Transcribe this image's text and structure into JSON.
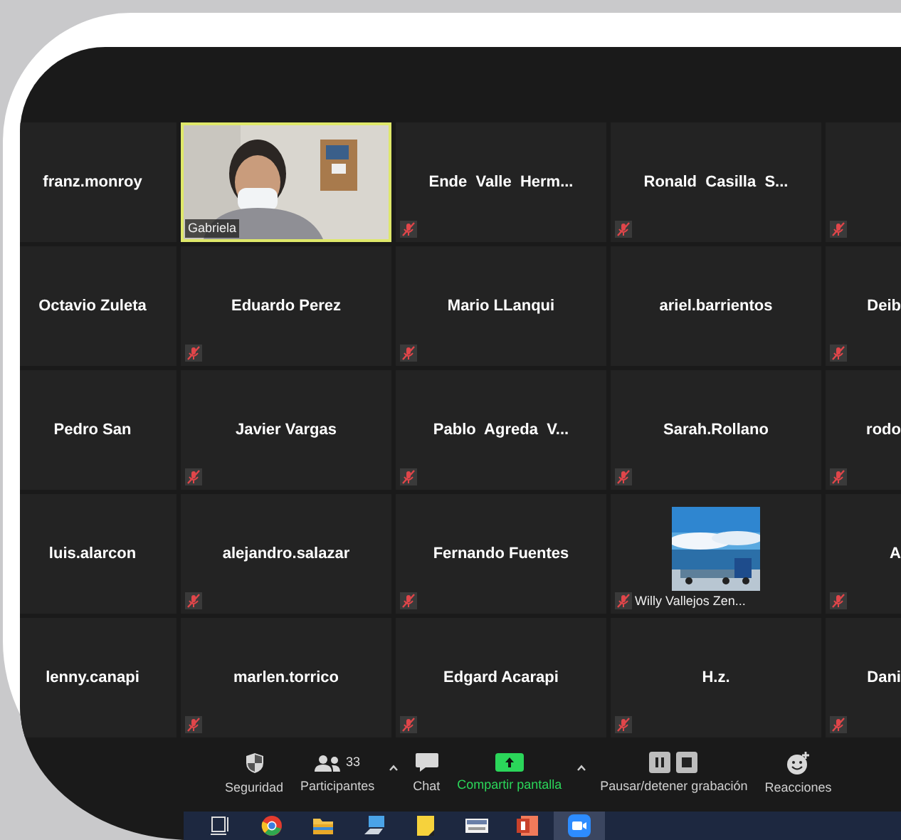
{
  "tiles": [
    {
      "kind": "name",
      "name": "franz.monroy",
      "muted": false,
      "active_speaker": false
    },
    {
      "kind": "video",
      "name": "Gabriela",
      "muted": false,
      "active_speaker": true
    },
    {
      "kind": "name",
      "name": "Ende  Valle  Herm...",
      "muted": true,
      "active_speaker": false
    },
    {
      "kind": "name",
      "name": "Ronald  Casilla  S...",
      "muted": true,
      "active_speaker": false
    },
    {
      "kind": "name",
      "muted": true,
      "active_speaker": false
    },
    {
      "kind": "name",
      "name": "Octavio Zuleta",
      "muted": false,
      "active_speaker": false
    },
    {
      "kind": "name",
      "name": "Eduardo Perez",
      "muted": true,
      "active_speaker": false
    },
    {
      "kind": "name",
      "name": "Mario LLanqui",
      "muted": true,
      "active_speaker": false
    },
    {
      "kind": "name",
      "name": "ariel.barrientos",
      "muted": false,
      "active_speaker": false
    },
    {
      "kind": "name",
      "name": "Deib",
      "muted": true,
      "active_speaker": false
    },
    {
      "kind": "name",
      "name": "Pedro San",
      "muted": false,
      "active_speaker": false
    },
    {
      "kind": "name",
      "name": "Javier Vargas",
      "muted": true,
      "active_speaker": false
    },
    {
      "kind": "name",
      "name": "Pablo  Agreda  V...",
      "muted": true,
      "active_speaker": false
    },
    {
      "kind": "name",
      "name": "Sarah.Rollano",
      "muted": true,
      "active_speaker": false
    },
    {
      "kind": "name",
      "name": "rodo",
      "muted": true,
      "active_speaker": false
    },
    {
      "kind": "name",
      "name": "luis.alarcon",
      "muted": false,
      "active_speaker": false
    },
    {
      "kind": "name",
      "name": "alejandro.salazar",
      "muted": true,
      "active_speaker": false
    },
    {
      "kind": "name",
      "name": "Fernando Fuentes",
      "muted": true,
      "active_speaker": false
    },
    {
      "kind": "avatar",
      "name": "Willy Vallejos Zen...",
      "muted": true,
      "active_speaker": false
    },
    {
      "kind": "name",
      "name": "A",
      "muted": true,
      "active_speaker": false
    },
    {
      "kind": "name",
      "name": "lenny.canapi",
      "muted": false,
      "active_speaker": false
    },
    {
      "kind": "name",
      "name": "marlen.torrico",
      "muted": true,
      "active_speaker": false
    },
    {
      "kind": "name",
      "name": "Edgard Acarapi",
      "muted": true,
      "active_speaker": false
    },
    {
      "kind": "name",
      "name": "H.z.",
      "muted": true,
      "active_speaker": false
    },
    {
      "kind": "name",
      "name": "Dani",
      "muted": true,
      "active_speaker": false
    }
  ],
  "toolbar": [
    {
      "kind": "security",
      "label": "Seguridad"
    },
    {
      "kind": "participants",
      "label": "Participantes",
      "count": "33",
      "menu": true
    },
    {
      "kind": "chat",
      "label": "Chat"
    },
    {
      "kind": "share",
      "label": "Compartir pantalla",
      "menu": true
    },
    {
      "kind": "record",
      "label": "Pausar/detener grabación"
    },
    {
      "kind": "reactions",
      "label": "Reacciones"
    }
  ],
  "taskbar": [
    {
      "kind": "taskview",
      "selected": false
    },
    {
      "kind": "browser",
      "selected": false
    },
    {
      "kind": "folder",
      "selected": false
    },
    {
      "kind": "computer",
      "selected": false
    },
    {
      "kind": "notes",
      "selected": false
    },
    {
      "kind": "card",
      "selected": false
    },
    {
      "kind": "slides",
      "selected": false
    },
    {
      "kind": "camera",
      "selected": true
    }
  ]
}
